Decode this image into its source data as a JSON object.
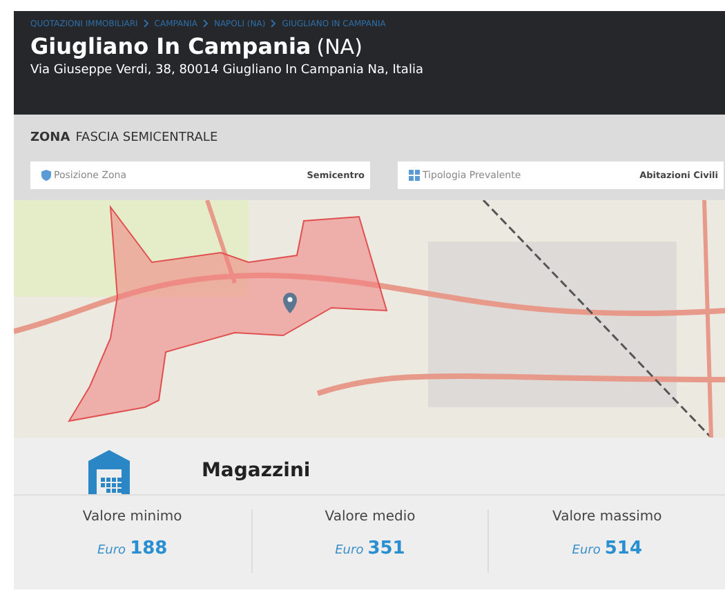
{
  "breadcrumb": [
    "QUOTAZIONI IMMOBILIARI",
    "CAMPANIA",
    "NAPOLI (NA)",
    "GIUGLIANO IN CAMPANIA"
  ],
  "header": {
    "city": "Giugliano In Campania",
    "province": "(NA)",
    "address": "Via Giuseppe Verdi, 38, 80014 Giugliano In Campania Na, Italia"
  },
  "zone": {
    "label": "ZONA",
    "value": "FASCIA SEMICENTRALE"
  },
  "zone_fields": [
    {
      "kind": "position",
      "label": "Posizione Zona",
      "value": "Semicentro"
    },
    {
      "kind": "typology",
      "label": "Tipologia Prevalente",
      "value": "Abitazioni Civili"
    }
  ],
  "category": {
    "title": "Magazzini"
  },
  "values": [
    {
      "label": "Valore minimo",
      "currency": "Euro",
      "amount": "188"
    },
    {
      "label": "Valore medio",
      "currency": "Euro",
      "amount": "351"
    },
    {
      "label": "Valore massimo",
      "currency": "Euro",
      "amount": "514"
    }
  ]
}
